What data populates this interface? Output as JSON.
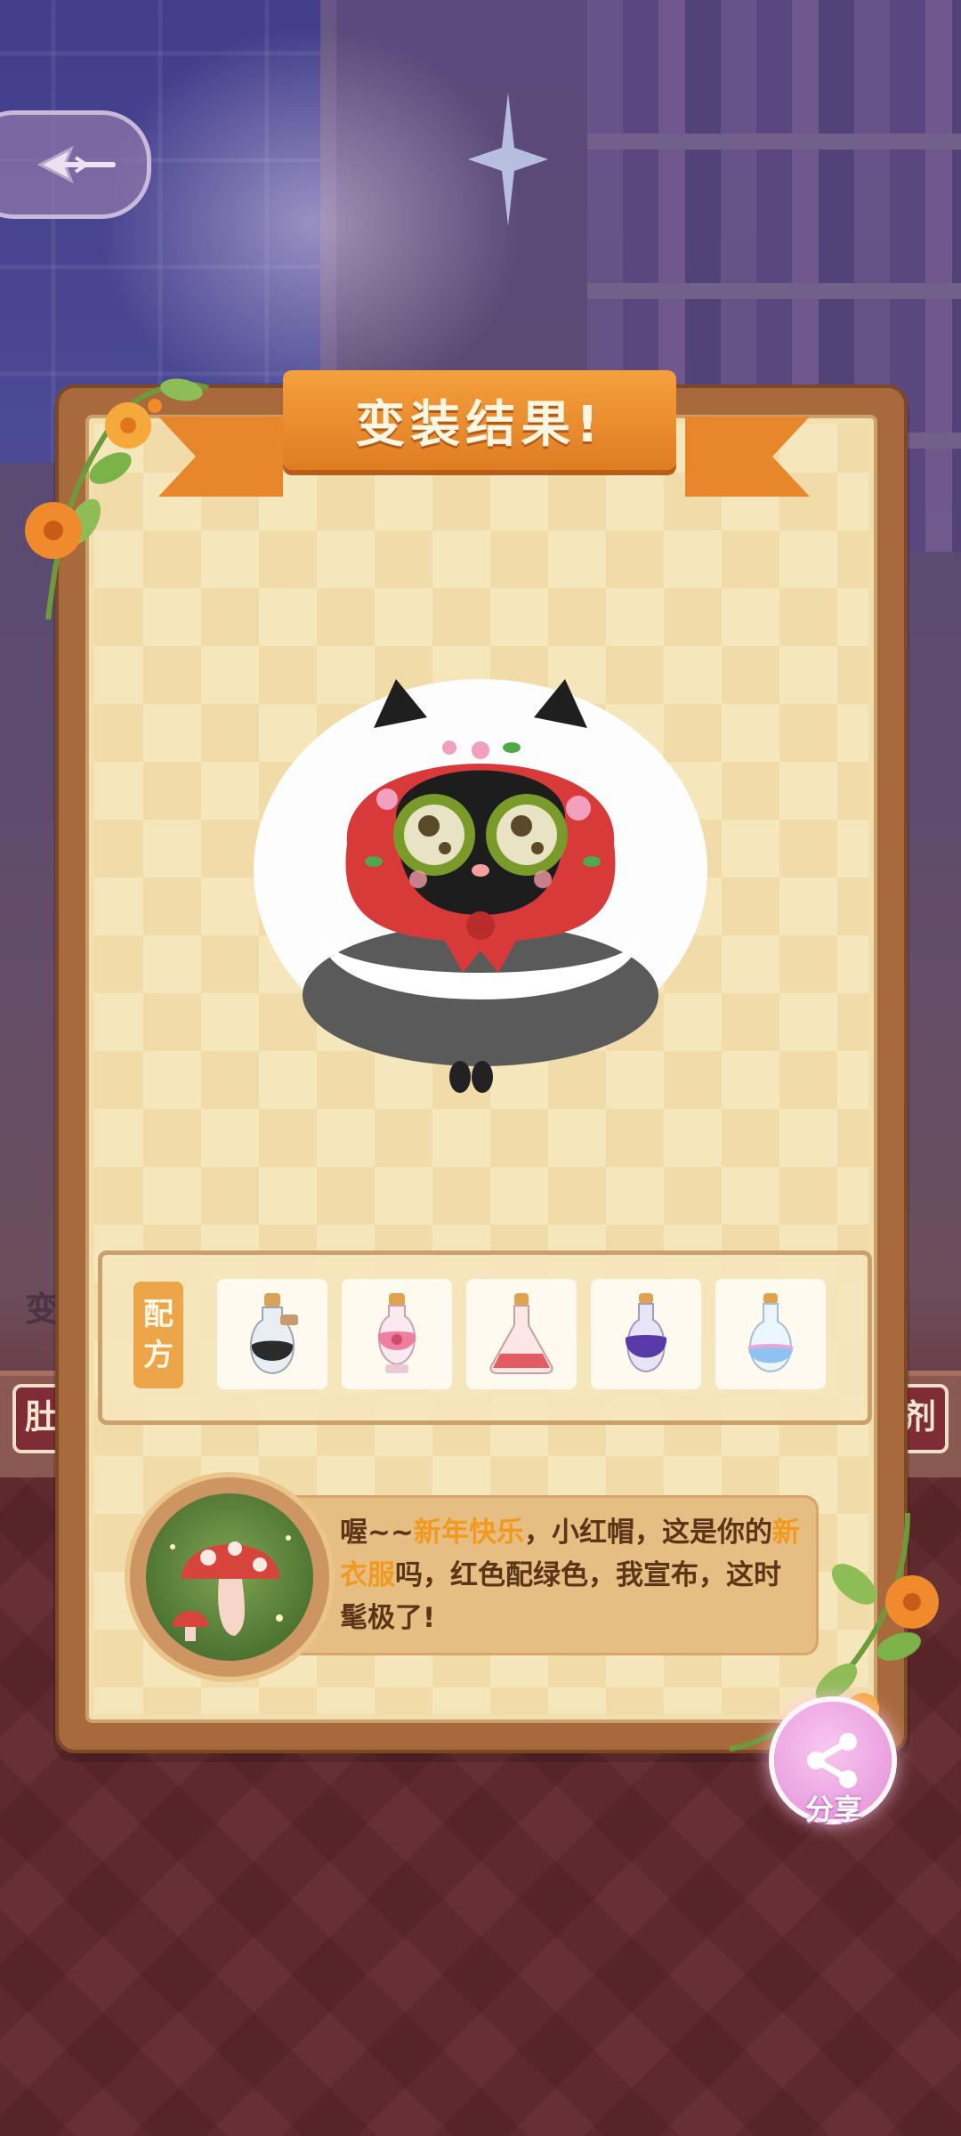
{
  "result_title": "变装结果!",
  "recipe": {
    "label_line1": "配",
    "label_line2": "方",
    "potions": [
      {
        "name": "black-potion-icon",
        "color": "#2b2b2b"
      },
      {
        "name": "pink-potion-icon",
        "color": "#ef7fa0"
      },
      {
        "name": "red-potion-icon",
        "color": "#e45b62"
      },
      {
        "name": "purple-potion-icon",
        "color": "#5a3aa8"
      },
      {
        "name": "blue-potion-icon",
        "color": "#8fc2ef"
      }
    ]
  },
  "dialogue": {
    "part1": "喔~~",
    "highlight1": "新年快乐",
    "part2": "，小红帽，这是你的",
    "highlight2": "新衣服",
    "part3": "吗，红色配绿色，我宣布，这时髦极了!"
  },
  "share": {
    "label": "分享"
  },
  "background": {
    "left_tag": "肚",
    "right_tag": "剂",
    "left_side_text": "变"
  },
  "colors": {
    "ribbon": "#e7862a",
    "highlight": "#f29a1f",
    "hood": "#d83a3a"
  }
}
